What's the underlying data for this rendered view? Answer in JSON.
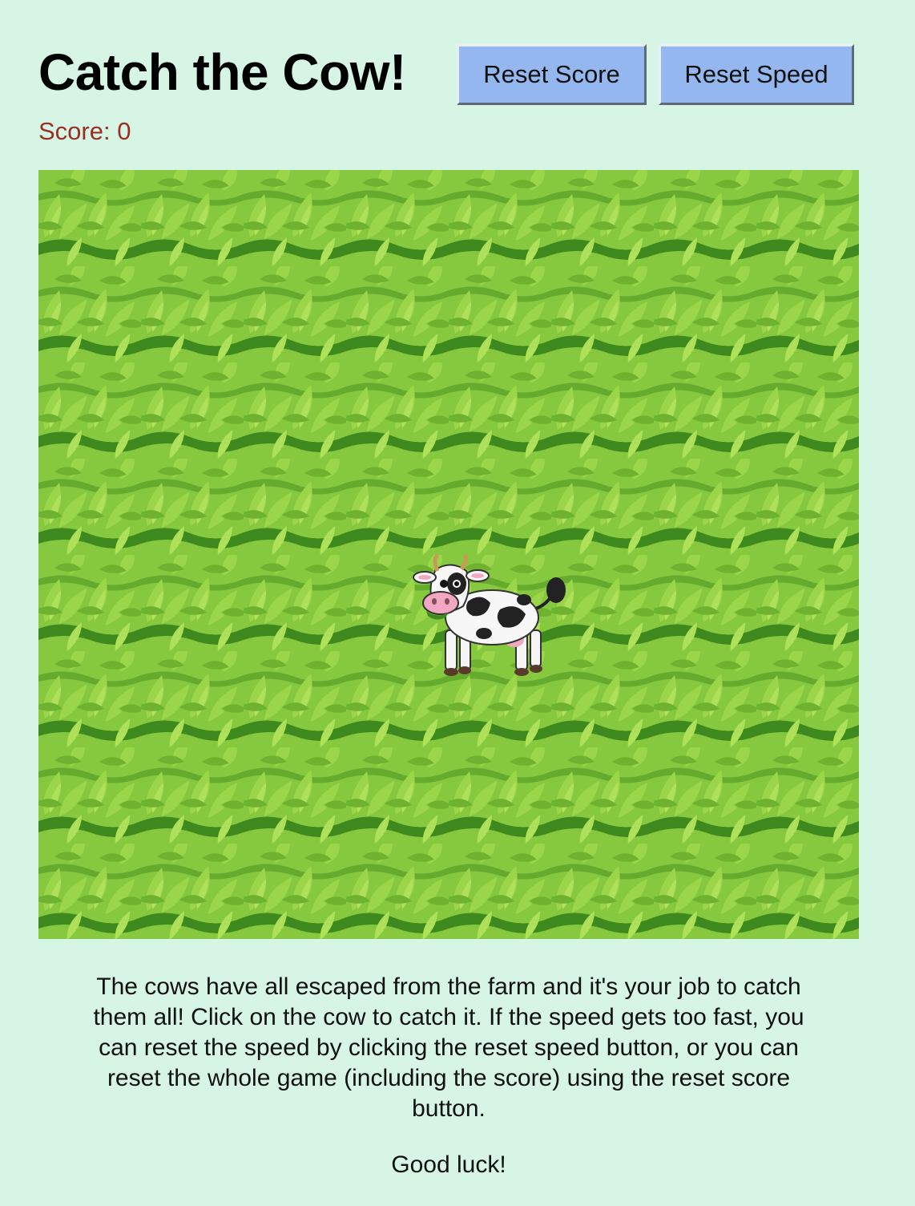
{
  "header": {
    "title": "Catch the Cow!",
    "reset_score_label": "Reset Score",
    "reset_speed_label": "Reset Speed"
  },
  "score": {
    "label": "Score:",
    "value": "0"
  },
  "game": {
    "background": "grass-field",
    "target": "cow-sprite"
  },
  "instructions": {
    "text": "The cows have all escaped from the farm and it's your job to catch them all! Click on the cow to catch it. If the speed gets too fast, you can reset the speed by clicking the reset speed button, or you can reset the whole game (including the score) using the reset score button.",
    "closing": "Good luck!"
  },
  "colors": {
    "page_background": "#d6f5e4",
    "button_background": "#93b7ee",
    "score_text": "#9a2f22",
    "grass": "#7cc13b"
  }
}
